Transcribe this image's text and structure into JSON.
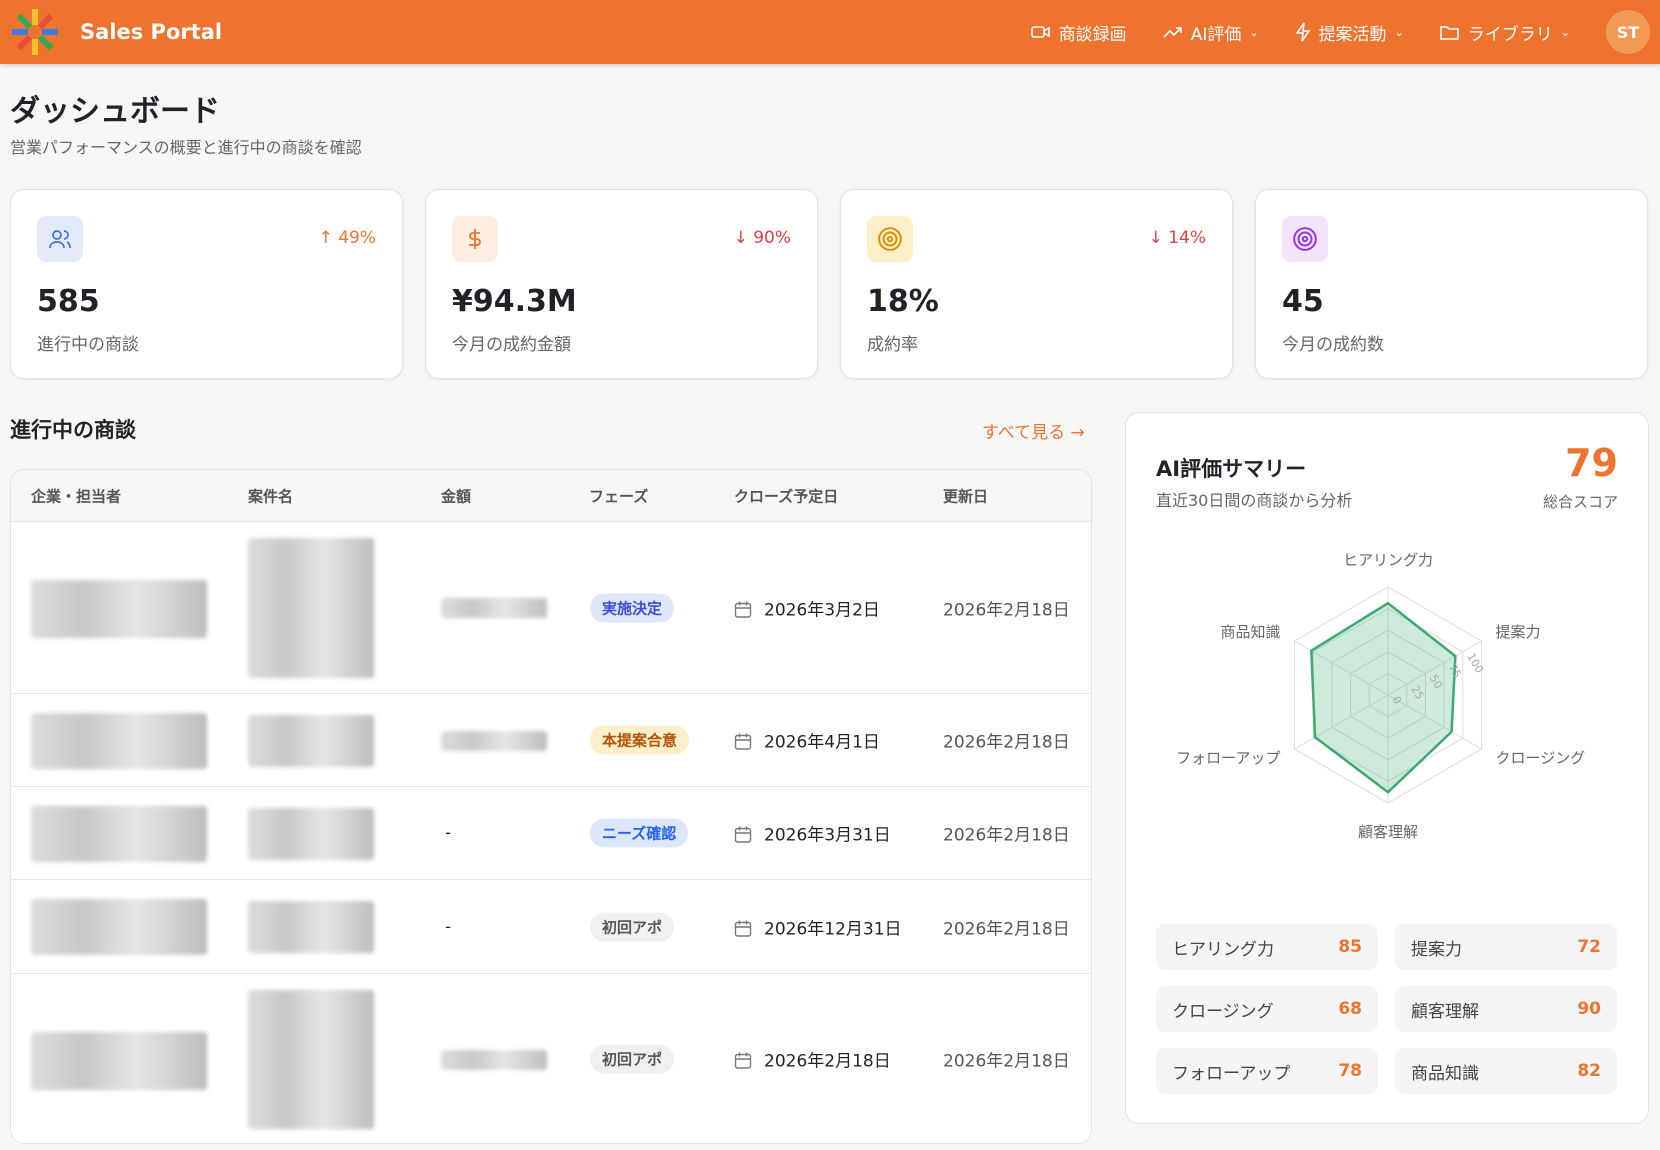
{
  "header": {
    "brand": "Sales Portal",
    "nav": [
      {
        "label": "商談録画",
        "icon": "video-icon"
      },
      {
        "label": "AI評価",
        "icon": "trend-icon"
      },
      {
        "label": "提案活動",
        "icon": "bolt-icon"
      },
      {
        "label": "ライブラリ",
        "icon": "folder-icon"
      }
    ],
    "avatar": "ST"
  },
  "page": {
    "title": "ダッシュボード",
    "subtitle": "営業パフォーマンスの概要と進行中の商談を確認"
  },
  "stats": [
    {
      "value": "585",
      "label": "進行中の商談",
      "trend": "↑ 49%",
      "trend_dir": "up",
      "icon": "users-icon",
      "color": "#3b6fe0"
    },
    {
      "value": "¥94.3M",
      "label": "今月の成約金額",
      "trend": "↓ 90%",
      "trend_dir": "down",
      "icon": "dollar-icon",
      "color": "#ee732e"
    },
    {
      "value": "18%",
      "label": "成約率",
      "trend": "↓ 14%",
      "trend_dir": "down",
      "icon": "target-icon",
      "color": "#e08a00"
    },
    {
      "value": "45",
      "label": "今月の成約数",
      "icon": "target-icon",
      "color": "#9333ea"
    }
  ],
  "deals": {
    "title": "進行中の商談",
    "see_all": "すべて見る →",
    "columns": [
      "企業・担当者",
      "案件名",
      "金額",
      "フェーズ",
      "クローズ予定日",
      "更新日"
    ],
    "rows": [
      {
        "amount": null,
        "phase": "実施決定",
        "phase_color": "#3b4fd8",
        "close": "2026年3月2日",
        "updated": "2026年2月18日"
      },
      {
        "amount": null,
        "phase": "本提案合意",
        "phase_color": "#b45309",
        "close": "2026年4月1日",
        "updated": "2026年2月18日"
      },
      {
        "amount": "-",
        "phase": "ニーズ確認",
        "phase_color": "#2563eb",
        "close": "2026年3月31日",
        "updated": "2026年2月18日"
      },
      {
        "amount": "-",
        "phase": "初回アポ",
        "phase_color": "#555555",
        "close": "2026年12月31日",
        "updated": "2026年2月18日"
      },
      {
        "amount": null,
        "phase": "初回アポ",
        "phase_color": "#555555",
        "close": "2026年2月18日",
        "updated": "2026年2月18日"
      }
    ]
  },
  "ai": {
    "title": "AI評価サマリー",
    "subtitle": "直近30日間の商談から分析",
    "score": "79",
    "score_label": "総合スコア",
    "scores": [
      {
        "label": "ヒアリング力",
        "value": "85"
      },
      {
        "label": "提案力",
        "value": "72"
      },
      {
        "label": "クロージング",
        "value": "68"
      },
      {
        "label": "顧客理解",
        "value": "90"
      },
      {
        "label": "フォローアップ",
        "value": "78"
      },
      {
        "label": "商品知識",
        "value": "82"
      }
    ]
  },
  "chart_data": {
    "type": "radar",
    "axes": [
      "ヒアリング力",
      "提案力",
      "クロージング",
      "顧客理解",
      "フォローアップ",
      "商品知識"
    ],
    "values": [
      85,
      72,
      68,
      90,
      78,
      82
    ],
    "ticks": [
      "0",
      "25",
      "50",
      "75",
      "100"
    ],
    "range": [
      0,
      100
    ],
    "color": "#3daa6e"
  }
}
